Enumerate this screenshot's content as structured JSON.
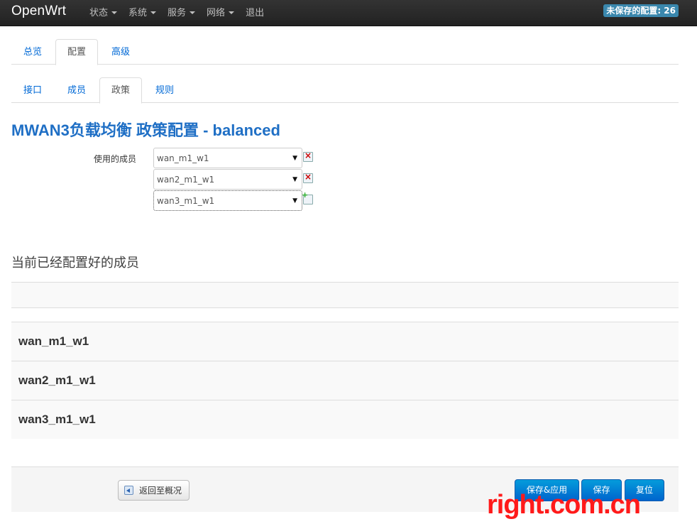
{
  "navbar": {
    "brand": "OpenWrt",
    "items": [
      {
        "label": "状态",
        "dropdown": true
      },
      {
        "label": "系统",
        "dropdown": true
      },
      {
        "label": "服务",
        "dropdown": true
      },
      {
        "label": "网络",
        "dropdown": true
      },
      {
        "label": "退出",
        "dropdown": false
      }
    ],
    "unsaved_badge": "未保存的配置: 26"
  },
  "main_tabs": [
    {
      "label": "总览",
      "active": false
    },
    {
      "label": "配置",
      "active": true
    },
    {
      "label": "高级",
      "active": false
    }
  ],
  "sub_tabs": [
    {
      "label": "接口",
      "active": false
    },
    {
      "label": "成员",
      "active": false
    },
    {
      "label": "政策",
      "active": true
    },
    {
      "label": "规则",
      "active": false
    }
  ],
  "page_title": "MWAN3负载均衡 政策配置 - balanced",
  "member_field": {
    "label": "使用的成员",
    "selects": [
      {
        "value": "wan_m1_w1",
        "action": "remove"
      },
      {
        "value": "wan2_m1_w1",
        "action": "remove"
      },
      {
        "value": "wan3_m1_w1",
        "action": "add"
      }
    ]
  },
  "configured_members": {
    "title": "当前已经配置好的成员",
    "items": [
      "wan_m1_w1",
      "wan2_m1_w1",
      "wan3_m1_w1"
    ]
  },
  "actions": {
    "back_label": "返回至概况",
    "save_apply_label": "保存&应用",
    "save_label": "保存",
    "reset_label": "复位"
  },
  "watermark": "right.com.cn",
  "colors": {
    "navbar_bg": "#222222",
    "badge_bg": "#3a87ad",
    "link": "#0069d6",
    "title": "#1f6fc5",
    "primary_button": "#0064cd",
    "watermark": "#ff1a1a"
  }
}
